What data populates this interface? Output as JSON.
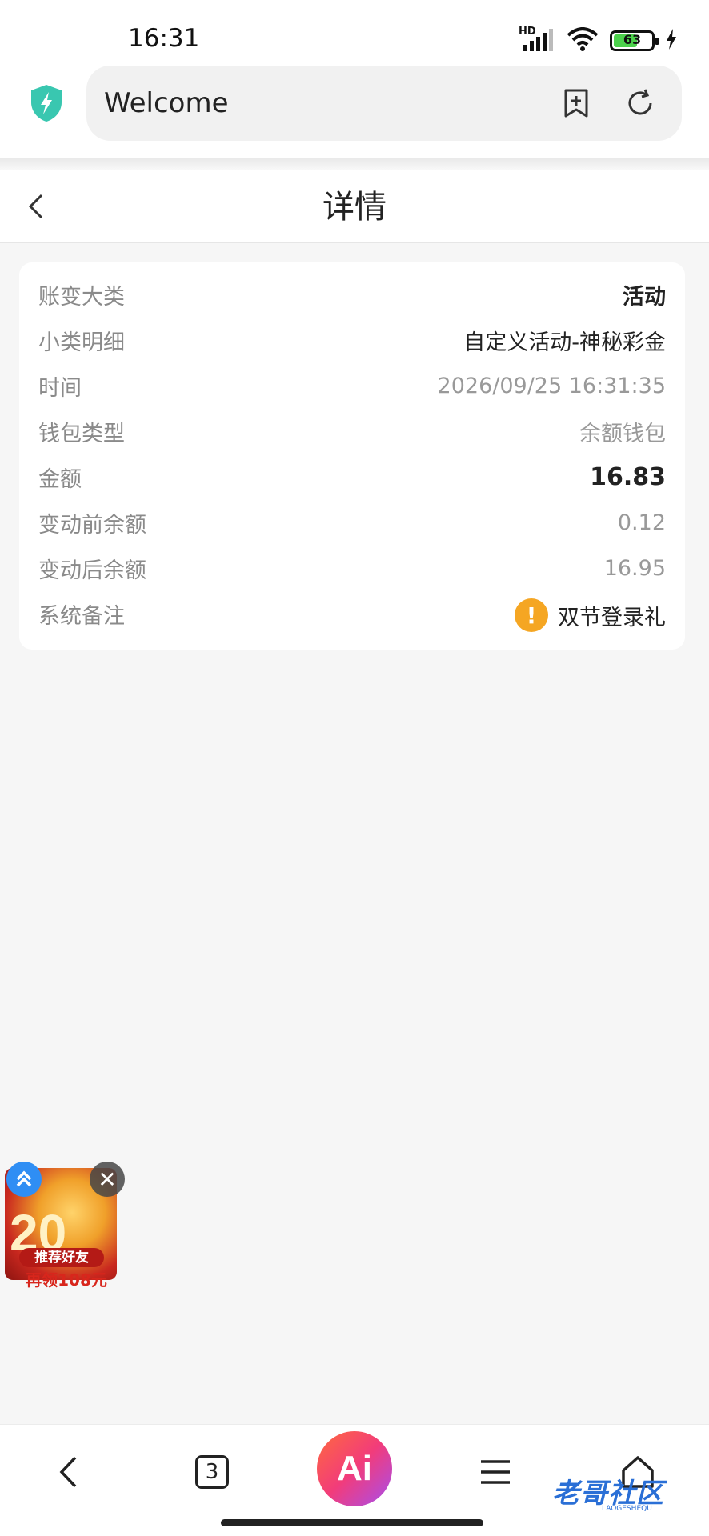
{
  "status_bar": {
    "time": "16:31",
    "network_label": "HD",
    "battery_level": "63",
    "battery_percent": 63
  },
  "browser": {
    "url_title": "Welcome"
  },
  "header": {
    "title": "详情"
  },
  "details": {
    "rows": [
      {
        "label": "账变大类",
        "value": "活动"
      },
      {
        "label": "小类明细",
        "value": "自定义活动-神秘彩金"
      },
      {
        "label": "时间",
        "value": "2026/09/25 16:31:35"
      },
      {
        "label": "钱包类型",
        "value": "余额钱包"
      },
      {
        "label": "金额",
        "value": "16.83"
      },
      {
        "label": "变动前余额",
        "value": "0.12"
      },
      {
        "label": "变动后余额",
        "value": "16.95"
      },
      {
        "label": "系统备注",
        "value": "双节登录礼"
      }
    ]
  },
  "floating_ad": {
    "number": "20",
    "pill_text": "推荐好友",
    "subtitle": "再领108元"
  },
  "bottom_nav": {
    "tab_count": "3",
    "ai_label": "Ai"
  },
  "watermark": {
    "text": "老哥社区",
    "subtext": "LAOGESHEQU"
  },
  "colors": {
    "accent_warning": "#f5a623",
    "shield": "#39c7b0",
    "ai_gradient_start": "#ff6a3d",
    "ai_gradient_end": "#a64ef0"
  }
}
